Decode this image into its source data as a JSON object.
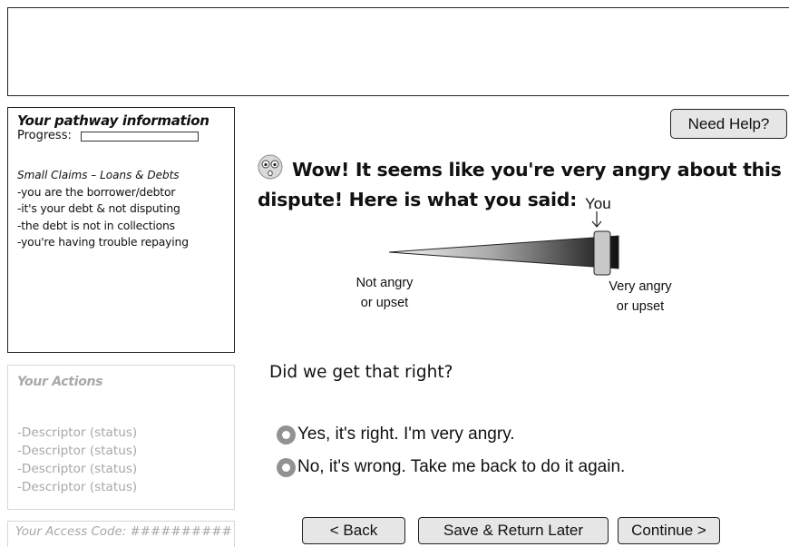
{
  "pathway": {
    "title": "Your pathway information",
    "progress_label": "Progress:",
    "progress_value": 0,
    "category": "Small Claims – Loans & Debts",
    "lines": [
      "-you are the borrower/debtor",
      "-it's your debt & not disputing",
      "-the debt is not in collections",
      "-you're having trouble repaying"
    ]
  },
  "actions": {
    "title": "Your Actions",
    "items": [
      "-Descriptor (status)",
      "-Descriptor (status)",
      "-Descriptor (status)",
      "-Descriptor (status)"
    ]
  },
  "access_code": "Your Access Code: ##########",
  "help_label": "Need Help?",
  "heading": {
    "line1": "Wow! It seems like you're very angry about this",
    "line2": "dispute! Here is what you said:"
  },
  "scale": {
    "marker_label": "You",
    "left_label_1": "Not angry",
    "left_label_2": "or upset",
    "right_label_1": "Very angry",
    "right_label_2": "or upset",
    "selected_level": 0.93
  },
  "question": "Did we get that right?",
  "options": [
    "Yes, it's right. I'm very angry.",
    "No, it's wrong. Take me back to do it again."
  ],
  "nav": {
    "back": "< Back",
    "save": "Save & Return Later",
    "continue": "Continue >"
  },
  "icons": {
    "face": "surprised-face-icon",
    "arrow": "arrow-down-icon"
  },
  "colors": {
    "button_bg": "#e6e6e6",
    "radio": "#929292",
    "muted_text": "#a8a8a8"
  }
}
